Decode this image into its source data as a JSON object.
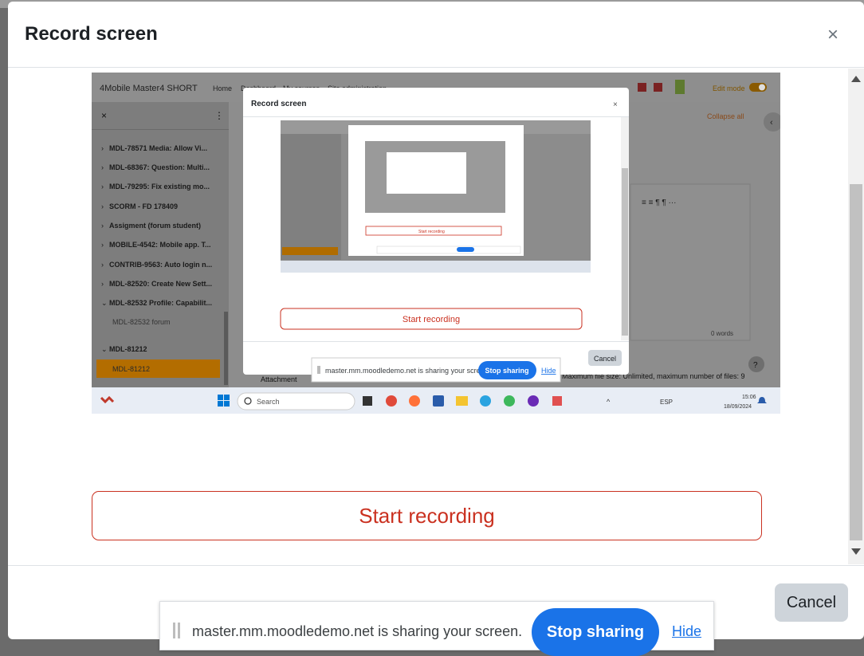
{
  "dialog": {
    "title": "Record screen",
    "close_label": "×"
  },
  "start_recording_label": "Start recording",
  "cancel_label": "Cancel",
  "share_bar": {
    "message": "master.mm.moodledemo.net is sharing your screen.",
    "stop_label": "Stop sharing",
    "hide_label": "Hide"
  },
  "preview": {
    "site_name": "4Mobile Master4 SHORT",
    "nav": [
      "Home",
      "Dashboard",
      "My courses",
      "Site administration"
    ],
    "edit_mode_label": "Edit mode",
    "collapse_all": "Collapse all",
    "sidebar_items": [
      "MDL-78571 Media: Allow Vi...",
      "MDL-68367: Question: Multi...",
      "MDL-79295: Fix existing mo...",
      "SCORM - FD 178409",
      "Assigment (forum student)",
      "MOBILE-4542: Mobile app. T...",
      "CONTRIB-9563: Auto login n...",
      "MDL-82520: Create New Sett...",
      "MDL-82532 Profile: Capabilit..."
    ],
    "sub_item": "MDL-82532 forum",
    "section_item": "MDL-81212",
    "active_item": "MDL-81212",
    "inner_dialog_title": "Record screen",
    "inner_start_label": "Start recording",
    "inner_cancel_label": "Cancel",
    "inner_share_message": "master.mm.moodledemo.net is sharing your screen.",
    "inner_stop_label": "Stop sharing",
    "inner_hide_label": "Hide",
    "attachment_label": "Attachment",
    "max_file_text": "Maximum file size: Unlimited, maximum number of files: 9",
    "words_label": "0 words",
    "help_label": "?",
    "taskbar": {
      "search_placeholder": "Search",
      "lang": "ESP",
      "time": "15:06",
      "date": "18/09/2024"
    }
  },
  "colors": {
    "accent": "#ca3120",
    "blue": "#1a73e8",
    "orange": "#f0a000"
  }
}
